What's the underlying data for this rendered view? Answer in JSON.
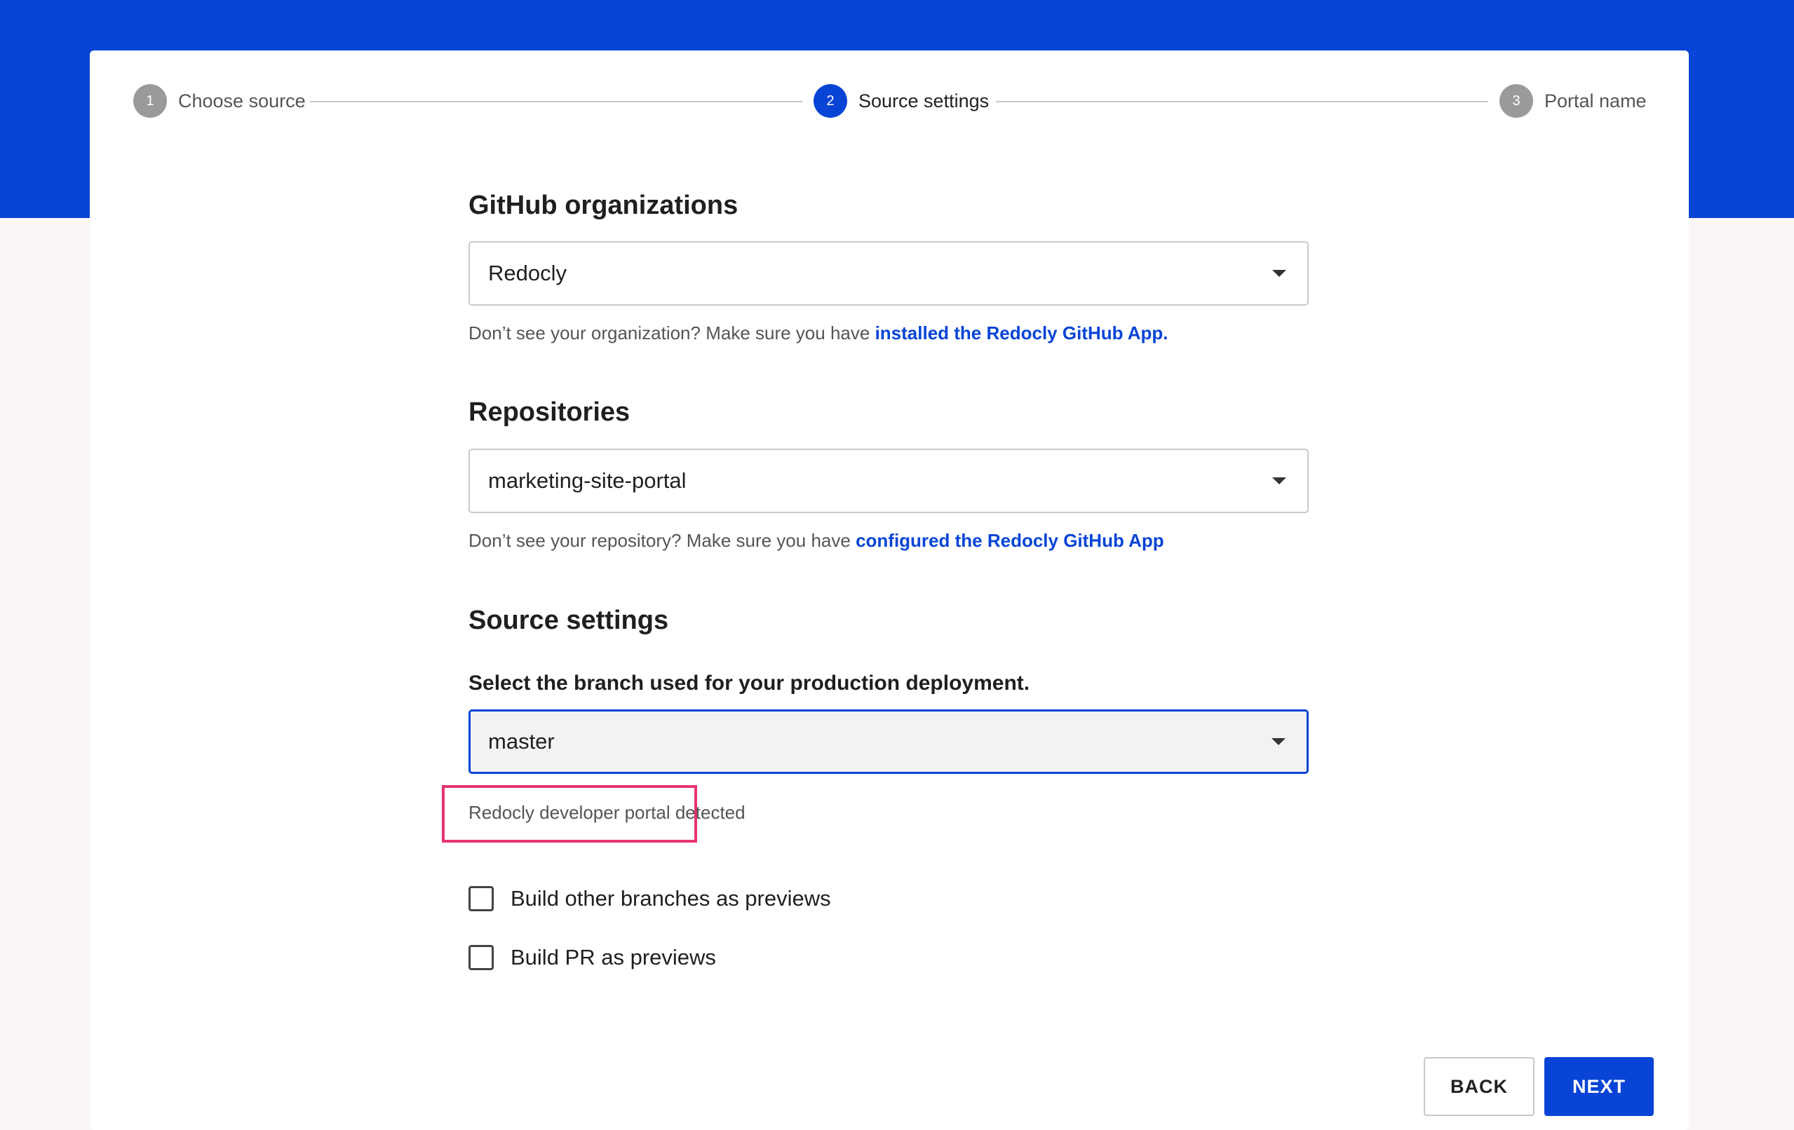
{
  "stepper": {
    "steps": [
      {
        "number": "1",
        "label": "Choose source"
      },
      {
        "number": "2",
        "label": "Source settings"
      },
      {
        "number": "3",
        "label": "Portal name"
      }
    ]
  },
  "org": {
    "title": "GitHub organizations",
    "selected": "Redocly",
    "help_text": "Don’t see your organization? Make sure you have ",
    "help_link": "installed the Redocly GitHub App."
  },
  "repo": {
    "title": "Repositories",
    "selected": "marketing-site-portal",
    "help_text": "Don’t see your repository? Make sure you have ",
    "help_link": "configured the Redocly GitHub App"
  },
  "source": {
    "title": "Source settings",
    "branch_label": "Select the branch used for your production deployment.",
    "branch_selected": "master",
    "detected": "Redocly developer portal detected",
    "options": [
      {
        "label": "Build other branches as previews",
        "checked": false
      },
      {
        "label": "Build PR as previews",
        "checked": false
      }
    ]
  },
  "actions": {
    "back": "BACK",
    "next": "NEXT"
  },
  "colors": {
    "brand": "#0844d6",
    "highlight": "#e8346f"
  }
}
